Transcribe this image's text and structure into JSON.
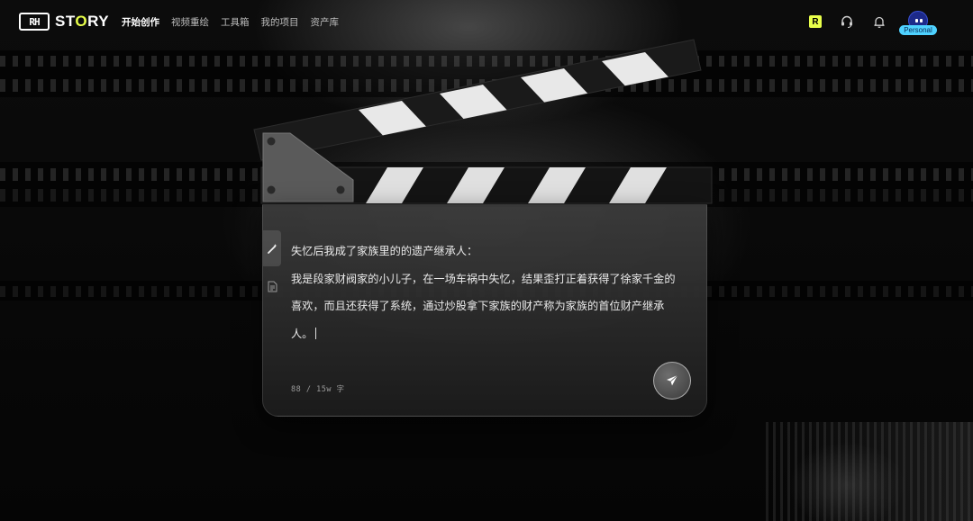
{
  "brand": {
    "mark": "RH",
    "name_pre": "ST",
    "name_o": "O",
    "name_post": "RY"
  },
  "nav": [
    {
      "label": "开始创作",
      "active": true
    },
    {
      "label": "视频重绘",
      "active": false
    },
    {
      "label": "工具箱",
      "active": false
    },
    {
      "label": "我的项目",
      "active": false
    },
    {
      "label": "资产库",
      "active": false
    }
  ],
  "header_right": {
    "r_badge": "R",
    "support_icon": "headset-icon",
    "notify_icon": "bell-icon",
    "avatar_label": "Personal"
  },
  "editor": {
    "lines": [
      "失忆后我成了家族里的的遗产继承人：",
      "我是段家财阀家的小儿子，在一场车祸中失忆，结果歪打正着获得了徐家千金的",
      "喜欢，而且还获得了系统，通过炒股拿下家族的财产称为家族的首位财产继承",
      "人。"
    ],
    "counter": "88 / 15w 字",
    "tool_icons": [
      "magic-wand-icon",
      "document-icon"
    ],
    "send_icon": "paper-plane-icon"
  },
  "colors": {
    "accent": "#e8ff4a",
    "personal_badge": "#4fd2ff",
    "background": "#0a0a0a"
  }
}
